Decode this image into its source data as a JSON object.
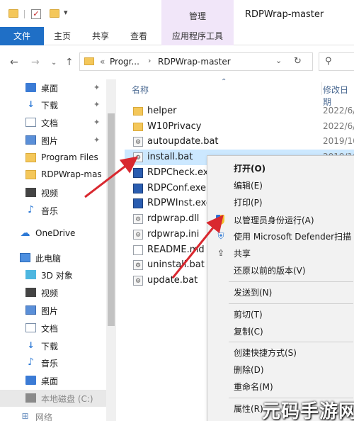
{
  "titlebar": {
    "context_tab": "管理",
    "window_title": "RDPWrap-master"
  },
  "ribbon": {
    "file": "文件",
    "home": "主页",
    "share": "共享",
    "view": "查看",
    "app_tools": "应用程序工具"
  },
  "address": {
    "prefix": "«",
    "segment1": "Progr...",
    "segment2": "RDPWrap-master"
  },
  "navpane": {
    "items": [
      {
        "label": "桌面",
        "icon": "desktop-icon",
        "pinned": true
      },
      {
        "label": "下载",
        "icon": "download-icon",
        "pinned": true
      },
      {
        "label": "文档",
        "icon": "documents-icon",
        "pinned": true
      },
      {
        "label": "图片",
        "icon": "pictures-icon",
        "pinned": true
      },
      {
        "label": "Program Files",
        "icon": "folder-icon",
        "pinned": false
      },
      {
        "label": "RDPWrap-mas",
        "icon": "folder-icon",
        "pinned": false
      },
      {
        "label": "视频",
        "icon": "videos-icon",
        "pinned": false
      },
      {
        "label": "音乐",
        "icon": "music-icon",
        "pinned": false
      },
      {
        "label": "OneDrive",
        "icon": "onedrive-icon",
        "pinned": false
      },
      {
        "label": "此电脑",
        "icon": "this-pc-icon",
        "pinned": false
      },
      {
        "label": "3D 对象",
        "icon": "3d-objects-icon",
        "pinned": false
      },
      {
        "label": "视频",
        "icon": "videos-icon",
        "pinned": false
      },
      {
        "label": "图片",
        "icon": "pictures-icon",
        "pinned": false
      },
      {
        "label": "文档",
        "icon": "documents-icon",
        "pinned": false
      },
      {
        "label": "下载",
        "icon": "download-icon",
        "pinned": false
      },
      {
        "label": "音乐",
        "icon": "music-icon",
        "pinned": false
      },
      {
        "label": "桌面",
        "icon": "desktop-icon",
        "pinned": false
      },
      {
        "label": "本地磁盘 (C:)",
        "icon": "drive-icon",
        "pinned": false
      },
      {
        "label": "网络",
        "icon": "network-icon",
        "pinned": false
      }
    ]
  },
  "filelist": {
    "columns": {
      "name": "名称",
      "modified": "修改日期"
    },
    "files": [
      {
        "name": "helper",
        "date": "2022/6/",
        "icon": "folder-icon"
      },
      {
        "name": "W10Privacy",
        "date": "2022/6/",
        "icon": "folder-icon"
      },
      {
        "name": "autoupdate.bat",
        "date": "2019/10",
        "icon": "batch-file-icon"
      },
      {
        "name": "install.bat",
        "date": "2019/10",
        "icon": "batch-file-icon",
        "selected": true
      },
      {
        "name": "RDPCheck.exe",
        "date": "",
        "icon": "exe-icon"
      },
      {
        "name": "RDPConf.exe",
        "date": "",
        "icon": "exe-icon"
      },
      {
        "name": "RDPWInst.exe",
        "date": "",
        "icon": "exe-icon"
      },
      {
        "name": "rdpwrap.dll",
        "date": "",
        "icon": "dll-icon"
      },
      {
        "name": "rdpwrap.ini",
        "date": "",
        "icon": "ini-icon"
      },
      {
        "name": "README.md",
        "date": "",
        "icon": "text-file-icon"
      },
      {
        "name": "uninstall.bat",
        "date": "",
        "icon": "batch-file-icon"
      },
      {
        "name": "update.bat",
        "date": "",
        "icon": "batch-file-icon"
      }
    ]
  },
  "context_menu": {
    "open": "打开(O)",
    "edit": "编辑(E)",
    "print": "打印(P)",
    "run_as_admin": "以管理员身份运行(A)",
    "defender": "使用 Microsoft Defender扫描",
    "share": "共享",
    "restore": "还原以前的版本(V)",
    "send_to": "发送到(N)",
    "cut": "剪切(T)",
    "copy": "复制(C)",
    "create_shortcut": "创建快捷方式(S)",
    "delete": "删除(D)",
    "rename": "重命名(M)",
    "properties": "属性(R)"
  },
  "watermark": "元码手游网",
  "colors": {
    "accent": "#1f6fc6",
    "selection": "#cce8ff",
    "context_tab": "#f1e6f9",
    "arrow": "#d9282f"
  }
}
